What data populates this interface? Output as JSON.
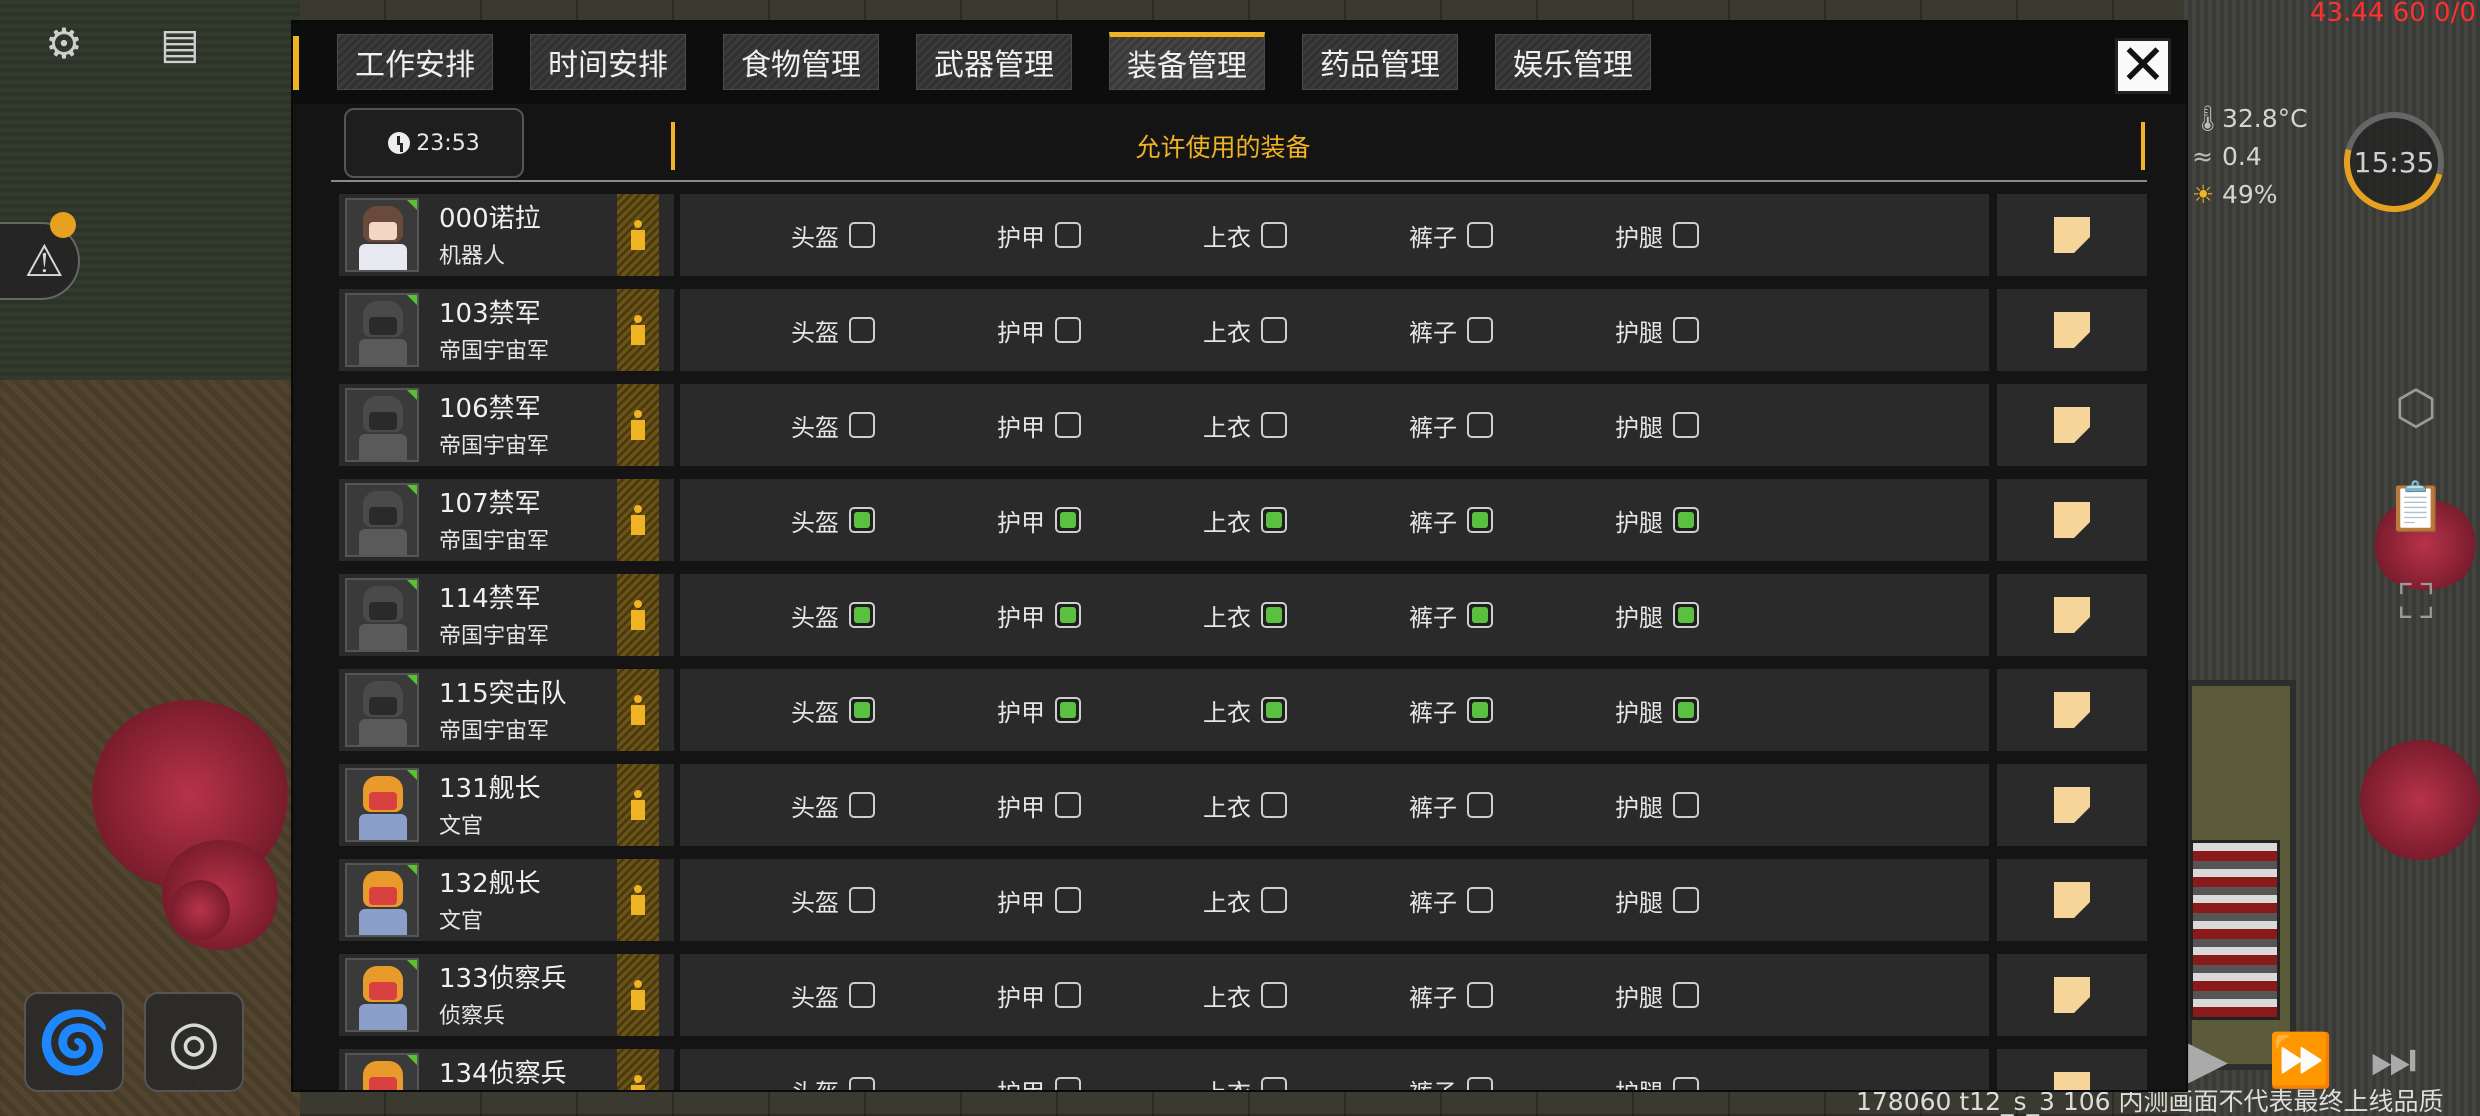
{
  "hud": {
    "top_right_readout": "43.44 60 0/0",
    "temperature": "32.8°C",
    "wind": "0.4",
    "light": "49%",
    "clock": "15:35",
    "build_info": "178060 t12_s_3 106  内测画面不代表最终上线品质"
  },
  "tabs": [
    {
      "label": "工作安排",
      "active": false
    },
    {
      "label": "时间安排",
      "active": false
    },
    {
      "label": "食物管理",
      "active": false
    },
    {
      "label": "武器管理",
      "active": false
    },
    {
      "label": "装备管理",
      "active": true
    },
    {
      "label": "药品管理",
      "active": false
    },
    {
      "label": "娱乐管理",
      "active": false
    }
  ],
  "close_label": "✕",
  "time_chip": "23:53",
  "header_title": "允许使用的装备",
  "gear_slots": [
    "头盔",
    "护甲",
    "上衣",
    "裤子",
    "护腿"
  ],
  "rows": [
    {
      "name": "000诺拉",
      "role": "机器人",
      "avatar": "human",
      "slots": [
        false,
        false,
        false,
        false,
        false
      ]
    },
    {
      "name": "103禁军",
      "role": "帝国宇宙军",
      "avatar": "guard",
      "slots": [
        false,
        false,
        false,
        false,
        false
      ]
    },
    {
      "name": "106禁军",
      "role": "帝国宇宙军",
      "avatar": "guard",
      "slots": [
        false,
        false,
        false,
        false,
        false
      ]
    },
    {
      "name": "107禁军",
      "role": "帝国宇宙军",
      "avatar": "guard",
      "slots": [
        true,
        true,
        true,
        true,
        true
      ]
    },
    {
      "name": "114禁军",
      "role": "帝国宇宙军",
      "avatar": "guard",
      "slots": [
        true,
        true,
        true,
        true,
        true
      ]
    },
    {
      "name": "115突击队",
      "role": "帝国宇宙军",
      "avatar": "guard",
      "slots": [
        true,
        true,
        true,
        true,
        true
      ]
    },
    {
      "name": "131舰长",
      "role": "文官",
      "avatar": "officer",
      "slots": [
        false,
        false,
        false,
        false,
        false
      ]
    },
    {
      "name": "132舰长",
      "role": "文官",
      "avatar": "officer",
      "slots": [
        false,
        false,
        false,
        false,
        false
      ]
    },
    {
      "name": "133侦察兵",
      "role": "侦察兵",
      "avatar": "officer",
      "slots": [
        false,
        false,
        false,
        false,
        false
      ]
    },
    {
      "name": "134侦察兵",
      "role": "",
      "avatar": "officer",
      "slots": [
        false,
        false,
        false,
        false,
        false
      ]
    }
  ]
}
